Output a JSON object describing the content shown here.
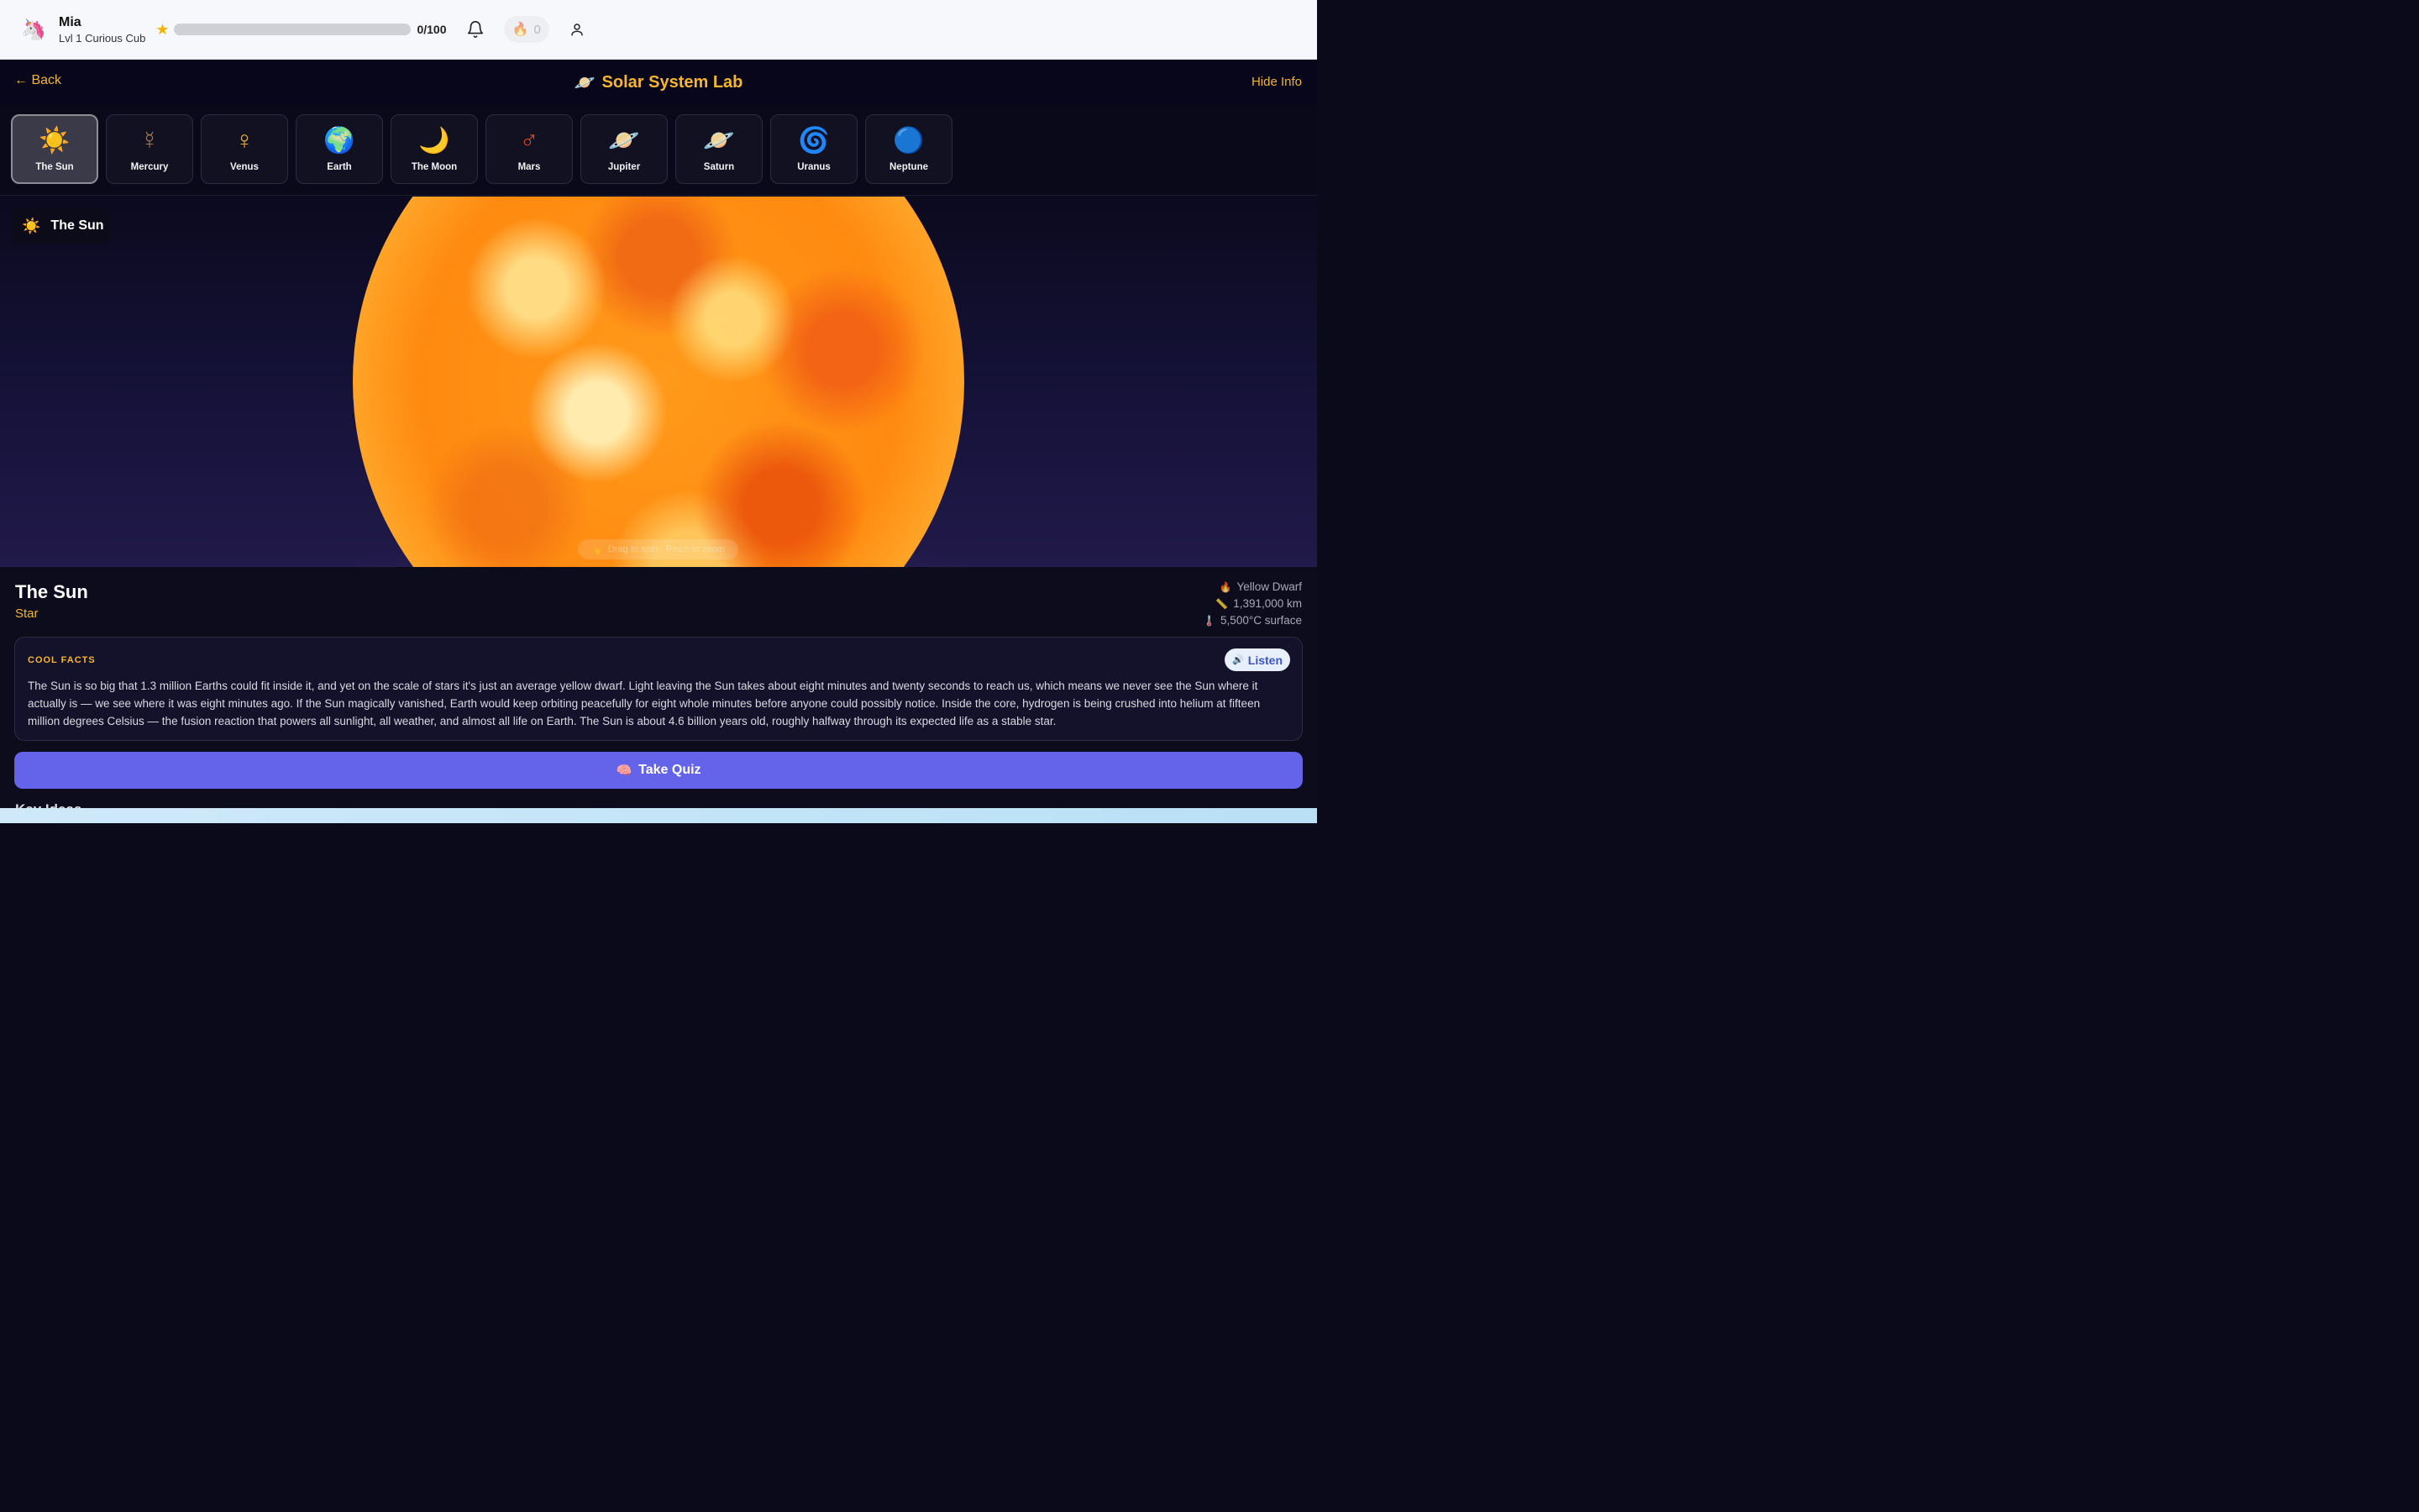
{
  "topbar": {
    "avatar_icon": "🦄",
    "user_name": "Mia",
    "user_level": "Lvl 1 Curious Cub",
    "star_icon": "★",
    "xp_progress": 0,
    "xp_text": "0/100",
    "bell_icon": "bell-icon",
    "streak_icon": "🔥",
    "streak_count": "0",
    "profile_icon": "user-icon"
  },
  "header": {
    "back_label": "← Back",
    "title_icon": "🪐",
    "title": "Solar System Lab",
    "hide_info_label": "Hide Info"
  },
  "tabs": [
    {
      "icon": "☀️",
      "label": "The Sun",
      "active": true
    },
    {
      "icon": "☿",
      "label": "Mercury",
      "active": false
    },
    {
      "icon": "♀",
      "label": "Venus",
      "active": false
    },
    {
      "icon": "🌍",
      "label": "Earth",
      "active": false
    },
    {
      "icon": "🌙",
      "label": "The Moon",
      "active": false
    },
    {
      "icon": "♂",
      "label": "Mars",
      "active": false
    },
    {
      "icon": "🪐",
      "label": "Jupiter",
      "active": false
    },
    {
      "icon": "🪐",
      "label": "Saturn",
      "active": false
    },
    {
      "icon": "🌀",
      "label": "Uranus",
      "active": false
    },
    {
      "icon": "🔵",
      "label": "Neptune",
      "active": false
    }
  ],
  "viewer": {
    "badge_icon": "☀️",
    "badge_label": "The Sun",
    "hint_icon": "👆",
    "hint_text": "Drag to spin · Pinch to zoom"
  },
  "info": {
    "name": "The Sun",
    "type": "Star",
    "stats": [
      {
        "icon": "🔥",
        "text": "Yellow Dwarf"
      },
      {
        "icon": "📏",
        "text": "1,391,000 km"
      },
      {
        "icon": "🌡️",
        "text": "5,500°C surface"
      }
    ],
    "facts_label": "COOL FACTS",
    "listen_icon": "🔊",
    "listen_label": "Listen",
    "facts_text": "The Sun is so big that 1.3 million Earths could fit inside it, and yet on the scale of stars it's just an average yellow dwarf. Light leaving the Sun takes about eight minutes and twenty seconds to reach us, which means we never see the Sun where it actually is — we see where it was eight minutes ago. If the Sun magically vanished, Earth would keep orbiting peacefully for eight whole minutes before anyone could possibly notice. Inside the core, hydrogen is being crushed into helium at fifteen million degrees Celsius — the fusion reaction that powers all sunlight, all weather, and almost all life on Earth. The Sun is about 4.6 billion years old, roughly halfway through its expected life as a stable star.",
    "quiz_icon": "🧠",
    "quiz_label": "Take Quiz",
    "key_ideas_label": "Key Ideas"
  },
  "colors": {
    "accent": "#f5b52e",
    "quiz_button": "#6364ea",
    "listen_text": "#3d55c4"
  }
}
